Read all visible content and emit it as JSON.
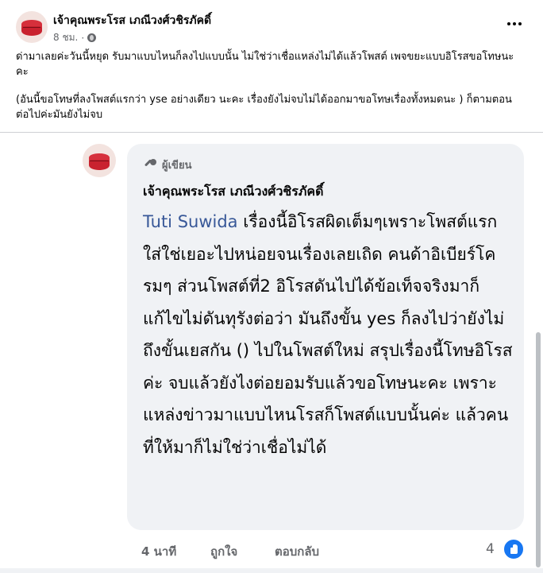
{
  "post": {
    "author_name": "เจ้าคุณพระโรส เภณีวงศ์วชิรภัคดิ์",
    "time": "8 ชม.",
    "separator": "·",
    "body_paragraph_1": "ด่ามาเลยค่ะวันนี้หยุด รับมาแบบไหนก็ลงไปแบบนั้น ไม่ใช่ว่าเชื่อแหล่งไม่ได้แล้วโพสต์ เพจขยะแบบอิโรสขอโทษนะคะ",
    "body_paragraph_2": "(อันนี้ขอโทษที่ลงโพสต์แรกว่า yse อย่างเดียว นะคะ เรื่องยังไม่จบไม่ได้ออกมาขอโทษเรื่องทั้งหมดนะ ) ก็ตามตอนต่อไปค่ะมันยังไม่จบ"
  },
  "comment": {
    "badge_label": "ผู้เขียน",
    "author_name": "เจ้าคุณพระโรส เภณีวงศ์วชิรภัคดิ์",
    "mention": "Tuti Suwida",
    "text": " เรื่องนี้อิโรสผิดเต็มๆเพราะโพสต์แรกใส่ใช่เยอะไปหน่อยจนเรื่องเลยเถิด คนด้าอิเบียร์โครมๆ ส่วนโพสต์ที่2 อิโรสดันไปได้ข้อเท็จจริงมาก็แก้ไขไม่ดันทุรังต่อว่า มันถึงขั้น yes ก็ลงไปว่ายังไม่ถึงขั้นเยสกัน () ไปในโพสต์ใหม่ สรุปเรื่องนี้โทษอิโรสค่ะ จบแล้วยังไงต่อยอมรับแล้วขอโทษนะคะ เพราะแหล่งข่าวมาแบบไหนโรสก็โพสต์แบบนั้นค่ะ แล้วคนที่ให้มาก็ไม่ใช่ว่าเชื่อไม่ได้",
    "time": "4 นาที",
    "like_label": "ถูกใจ",
    "reply_label": "ตอบกลับ",
    "reaction_count": "4"
  },
  "icons": {
    "privacy": "globe-icon",
    "more": "more-options-icon",
    "badge": "microphone-icon",
    "reaction": "like-icon"
  },
  "colors": {
    "mention": "#385898",
    "bubble": "#f0f2f5",
    "like_blue": "#1877f2",
    "secondary_text": "#65676b"
  }
}
